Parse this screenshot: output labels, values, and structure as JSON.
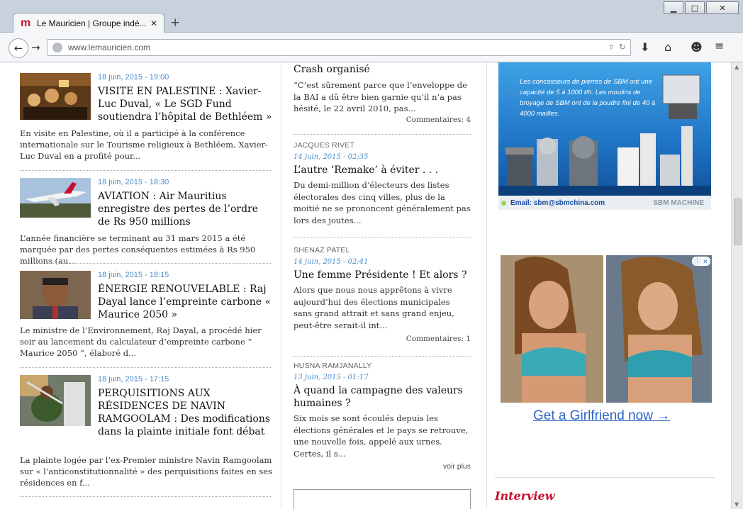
{
  "browser": {
    "tab_title": "Le Mauricien | Groupe indé...",
    "favicon_letter": "m",
    "url": "www.lemauricien.com"
  },
  "left_stories": [
    {
      "date": "18 juin, 2015 - 19:00",
      "title": "VISITE EN PALESTINE : Xavier-Luc Duval, « Le SGD Fund soutiendra l’hôpital de Bethléem »",
      "excerpt": "En visite en Palestine, où il a participé à la conférence internationale sur le Tourisme religieux à Bethléem, Xavier-Luc Duval en a profité pour..."
    },
    {
      "date": "18 juin, 2015 - 18:30",
      "title": "AVIATION : Air Mauritius enregistre des pertes de l’ordre de Rs 950 millions",
      "excerpt": "L’année financière se terminant au 31 mars 2015 a été marquée par des pertes conséquentes estimées à Rs 950 millions (au..."
    },
    {
      "date": "18 juin, 2015 - 18:15",
      "title": "ÉNERGIE RENOUVELABLE : Raj Dayal lance l’empreinte carbone « Maurice 2050 »",
      "excerpt": "Le ministre de l’Environnement, Raj Dayal, a procédé hier soir au lancement du calculateur d’empreinte carbone “ Maurice 2050 ”, élaboré d..."
    },
    {
      "date": "18 juin, 2015 - 17:15",
      "title": "PERQUISITIONS AUX RÉSIDENCES DE NAVIN RAMGOOLAM : Des modifications dans la plainte initiale font débat",
      "excerpt": "La plainte logée par l’ex-Premier ministre Navin Ramgoolam sur « l’anticonstitutionnalité » des perquisitions faites en ses résidences en f..."
    }
  ],
  "opinion": {
    "top": {
      "title": "Crash organisé",
      "excerpt": "“C’est sûrement parce que l’enveloppe de la BAI a dû être bien garnie qu’il n’a pas hésité, le 22 avril 2010, pas...",
      "comments": "Commentaires: 4"
    },
    "items": [
      {
        "author": "Jacques Rivet",
        "date": "14 juin, 2015 - 02:35",
        "title": "L’autre ‘Remake’ à éviter . . .",
        "excerpt": "Du demi-million d’électeurs des listes électorales des cinq villes, plus de la moitié ne se prononcent généralement pas lors des joutes...",
        "comments": ""
      },
      {
        "author": "Shenaz Patel",
        "date": "14 juin, 2015 - 02:41",
        "title": "Une femme Présidente ! Et alors ?",
        "excerpt": "Alors que nous nous apprêtons à vivre aujourd’hui des élections municipales sans grand attrait et sans grand enjeu, peut-être serait-il int...",
        "comments": "Commentaires: 1"
      },
      {
        "author": "Husna Ramjanally",
        "date": "13 juin, 2015 - 01:17",
        "title": "À quand la campagne des valeurs humaines ?",
        "excerpt": "Six mois se sont écoulés depuis les élections générales et le pays se retrouve, une nouvelle fois, appelé aux urnes. Certes, il s...",
        "comments": ""
      }
    ],
    "more": "voir plus"
  },
  "sidebar": {
    "ad1": {
      "text": "Les concasseurs de pierres de SBM ont une capacité de 5 à 1000 t/h. Les moulins de broyage de SBM ont de la poudre fini de 40 à 4000 mailles.",
      "email_label": "Email:",
      "email": "sbm@sbmchina.com",
      "brand": "SBM MACHINE"
    },
    "ad2": {
      "link": "Get a Girlfriend now →"
    },
    "section": "Interview"
  }
}
